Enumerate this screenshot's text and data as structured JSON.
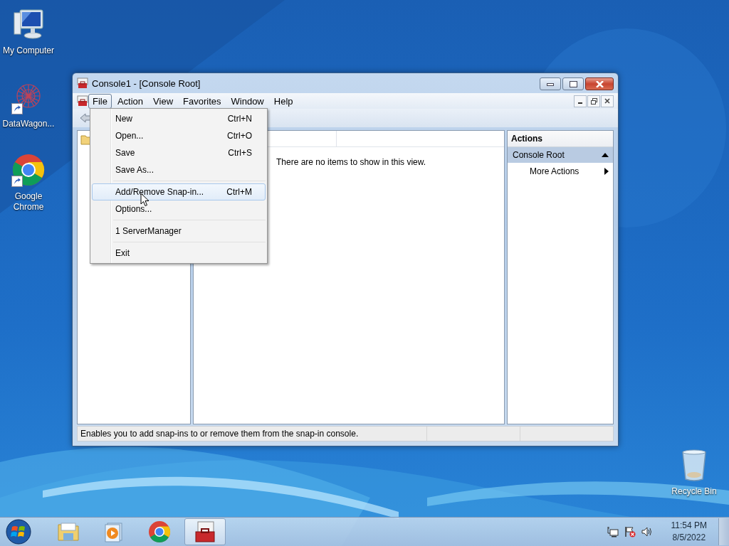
{
  "desktop_icons": [
    {
      "label": "My Computer",
      "kind": "computer",
      "shortcut": false
    },
    {
      "label": "DataWagon...",
      "kind": "web",
      "shortcut": true
    },
    {
      "label": "Google Chrome",
      "kind": "chrome",
      "shortcut": true
    },
    {
      "label": "Recycle Bin",
      "kind": "recycle",
      "shortcut": false
    }
  ],
  "window": {
    "title": "Console1 - [Console Root]",
    "menu": [
      {
        "label": "File",
        "selected": true
      },
      {
        "label": "Action",
        "selected": false
      },
      {
        "label": "View",
        "selected": false
      },
      {
        "label": "Favorites",
        "selected": false
      },
      {
        "label": "Window",
        "selected": false
      },
      {
        "label": "Help",
        "selected": false
      }
    ],
    "result_pane": {
      "message": "There are no items to show in this view."
    },
    "actions_pane": {
      "title": "Actions",
      "section": {
        "label": "Console Root",
        "expanded": true
      },
      "items": [
        {
          "label": "More Actions",
          "submenu": true
        }
      ]
    },
    "status_bar": {
      "text": "Enables you to add snap-ins to or remove them from the snap-in console."
    }
  },
  "file_menu": {
    "groups": [
      [
        {
          "label": "New",
          "shortcut": "Ctrl+N",
          "selected": false
        },
        {
          "label": "Open...",
          "shortcut": "Ctrl+O",
          "selected": false
        },
        {
          "label": "Save",
          "shortcut": "Ctrl+S",
          "selected": false
        },
        {
          "label": "Save As...",
          "selected": false
        }
      ],
      [
        {
          "label": "Add/Remove Snap-in...",
          "shortcut": "Ctrl+M",
          "selected": true
        },
        {
          "label": "Options...",
          "selected": false
        }
      ],
      [
        {
          "label": "1 ServerManager",
          "selected": false
        }
      ],
      [
        {
          "label": "Exit",
          "selected": false
        }
      ]
    ]
  },
  "taskbar": {
    "items": [
      {
        "kind": "explorer",
        "active": false
      },
      {
        "kind": "media",
        "active": false
      },
      {
        "kind": "chrome",
        "active": false
      },
      {
        "kind": "toolbox",
        "active": true
      }
    ],
    "clock": {
      "time": "11:54 PM",
      "date": "8/5/2022"
    }
  }
}
